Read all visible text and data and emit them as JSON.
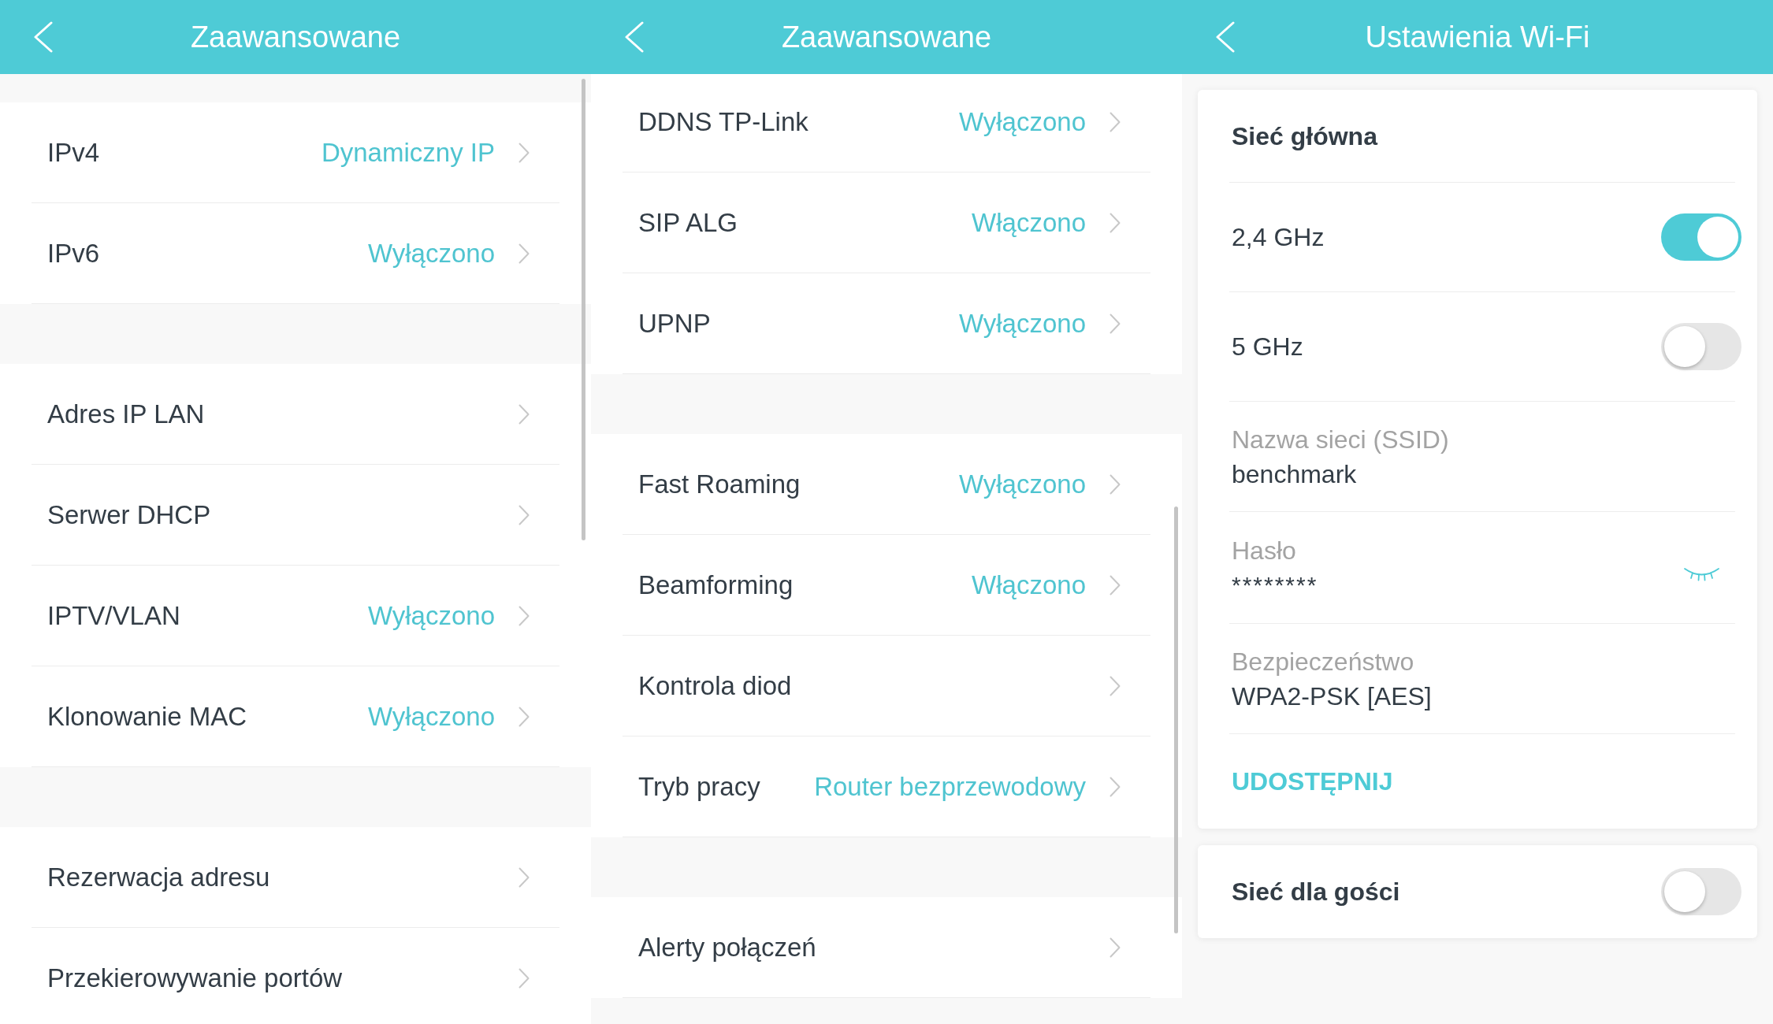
{
  "screens": [
    {
      "kind": "list",
      "title": "Zaawansowane",
      "sections": [
        {
          "items": [
            {
              "label": "IPv4",
              "value": "Dynamiczny IP"
            },
            {
              "label": "IPv6",
              "value": "Wyłączono"
            }
          ]
        },
        {
          "items": [
            {
              "label": "Adres IP LAN"
            },
            {
              "label": "Serwer DHCP"
            },
            {
              "label": "IPTV/VLAN",
              "value": "Wyłączono"
            },
            {
              "label": "Klonowanie MAC",
              "value": "Wyłączono"
            }
          ]
        },
        {
          "items": [
            {
              "label": "Rezerwacja adresu"
            },
            {
              "label": "Przekierowywanie portów"
            }
          ]
        }
      ]
    },
    {
      "kind": "list",
      "title": "Zaawansowane",
      "sections": [
        {
          "items": [
            {
              "label": "DDNS TP-Link",
              "value": "Wyłączono"
            },
            {
              "label": "SIP ALG",
              "value": "Włączono"
            },
            {
              "label": "UPNP",
              "value": "Wyłączono"
            }
          ]
        },
        {
          "items": [
            {
              "label": "Fast Roaming",
              "value": "Wyłączono"
            },
            {
              "label": "Beamforming",
              "value": "Włączono"
            },
            {
              "label": "Kontrola diod"
            },
            {
              "label": "Tryb pracy",
              "value": "Router bezprzewodowy"
            }
          ]
        },
        {
          "items": [
            {
              "label": "Alerty połączeń"
            }
          ]
        }
      ]
    },
    {
      "kind": "form",
      "title": "Ustawienia Wi-Fi",
      "cards": [
        {
          "title": "Sieć główna",
          "rows": [
            {
              "kind": "toggle",
              "label": "2,4 GHz",
              "on": true
            },
            {
              "kind": "toggle",
              "label": "5 GHz",
              "on": false
            },
            {
              "kind": "field",
              "label": "Nazwa sieci (SSID)",
              "value": "benchmark"
            },
            {
              "kind": "password",
              "label": "Hasło",
              "value": "********"
            },
            {
              "kind": "field",
              "label": "Bezpieczeństwo",
              "value": "WPA2-PSK [AES]"
            },
            {
              "kind": "action",
              "label": "UDOSTĘPNIJ"
            }
          ]
        },
        {
          "title": "Sieć dla gości",
          "on": false
        }
      ]
    }
  ]
}
